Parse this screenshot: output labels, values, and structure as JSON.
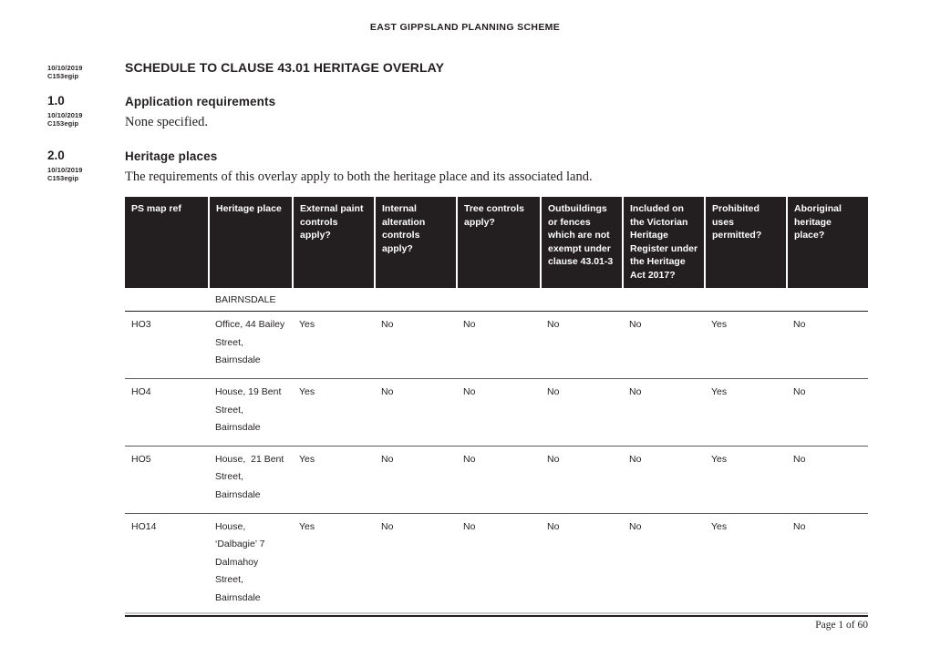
{
  "document": {
    "running_header": "EAST GIPPSLAND PLANNING SCHEME",
    "title": "SCHEDULE TO CLAUSE 43.01 HERITAGE OVERLAY",
    "title_meta": {
      "date": "10/10/2019",
      "amendment": "C153egip"
    },
    "footer": "Page 1 of 60"
  },
  "sections": [
    {
      "number": "1.0",
      "heading": "Application requirements",
      "meta": {
        "date": "10/10/2019",
        "amendment": "C153egip"
      },
      "body": "None specified."
    },
    {
      "number": "2.0",
      "heading": "Heritage places",
      "meta": {
        "date": "10/10/2019",
        "amendment": "C153egip"
      },
      "body": "The requirements of this overlay apply to both the heritage place and its associated land."
    }
  ],
  "table": {
    "columns": [
      "PS map ref",
      "Heritage place",
      "External paint controls apply?",
      "Internal alteration controls apply?",
      "Tree controls apply?",
      "Outbuildings or fences which are not exempt under clause  43.01-3",
      "Included on the Victorian Heritage Register under the Heritage Act 2017?",
      "Prohibited uses permitted?",
      "Aboriginal heritage place?"
    ],
    "group_label": "BAIRNSDALE",
    "rows": [
      {
        "ps_map_ref": "HO3",
        "heritage_place": "Office, 44 Bailey Street, Bairnsdale",
        "external_paint": "Yes",
        "internal_alteration": "No",
        "tree_controls": "No",
        "outbuildings_fences": "No",
        "vhr_included": "No",
        "prohibited_uses": "Yes",
        "aboriginal_heritage": "No"
      },
      {
        "ps_map_ref": "HO4",
        "heritage_place": "House, 19 Bent Street, Bairnsdale",
        "external_paint": "Yes",
        "internal_alteration": "No",
        "tree_controls": "No",
        "outbuildings_fences": "No",
        "vhr_included": "No",
        "prohibited_uses": "Yes",
        "aboriginal_heritage": "No"
      },
      {
        "ps_map_ref": "HO5",
        "heritage_place": "House,  21 Bent Street, Bairnsdale",
        "external_paint": "Yes",
        "internal_alteration": "No",
        "tree_controls": "No",
        "outbuildings_fences": "No",
        "vhr_included": "No",
        "prohibited_uses": "Yes",
        "aboriginal_heritage": "No"
      },
      {
        "ps_map_ref": "HO14",
        "heritage_place": "House, ‘Dalbagie’ 7 Dalmahoy Street, Bairnsdale",
        "external_paint": "Yes",
        "internal_alteration": "No",
        "tree_controls": "No",
        "outbuildings_fences": "No",
        "vhr_included": "No",
        "prohibited_uses": "Yes",
        "aboriginal_heritage": "No"
      }
    ]
  },
  "colors": {
    "header_fill": "#231f20",
    "header_text": "#ffffff",
    "body_text": "#231f20",
    "rule_light": "#c9c9c9",
    "rule_row": "#5b5b5b"
  }
}
